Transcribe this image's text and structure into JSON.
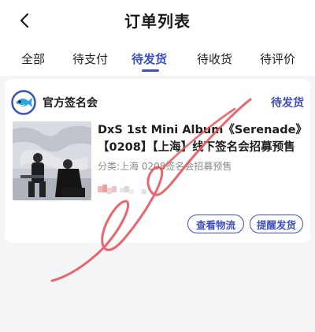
{
  "header": {
    "title": "订单列表",
    "back_icon": "chevron-left-icon"
  },
  "tabs": [
    {
      "label": "全部"
    },
    {
      "label": "待支付"
    },
    {
      "label": "待发货",
      "active": true
    },
    {
      "label": "待收货"
    },
    {
      "label": "待评价"
    }
  ],
  "order": {
    "shop_name": "官方签名会",
    "shop_logo_icon": "fish-logo-icon",
    "status": "待发货",
    "product_title": "DxS 1st Mini Album《Serenade》【0208】【上海】线下签名会招募预售",
    "product_spec": "分类:上海 0208签名会招募预售",
    "actions": {
      "logistics_label": "查看物流",
      "remind_label": "提醒发货"
    }
  },
  "colors": {
    "accent": "#3d4fbf",
    "scribble": "#e8545c",
    "background": "#f4f5f7"
  }
}
